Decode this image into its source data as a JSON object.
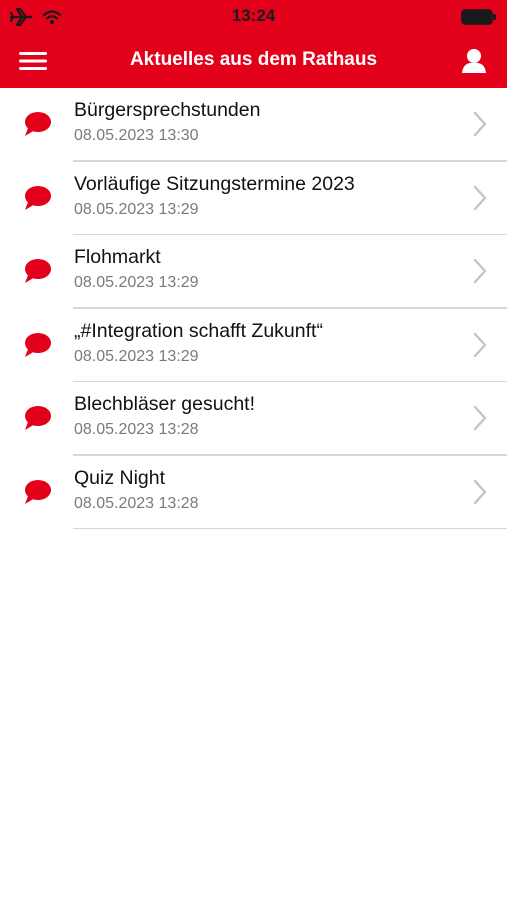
{
  "status_bar": {
    "time": "13:24",
    "icons": [
      "airplane-icon",
      "wifi-icon",
      "battery-icon"
    ]
  },
  "header": {
    "title": "Aktuelles aus dem Rathaus",
    "left_icon": "menu-icon",
    "right_icon": "user-icon"
  },
  "colors": {
    "brand": "#e2001a",
    "divider": "#d6d6d6",
    "chevron": "#c4c4c8"
  },
  "news": {
    "items": [
      {
        "title": "Bürgersprechstunden",
        "date": "08.05.2023 13:30"
      },
      {
        "title": "Vorläufige Sitzungstermine 2023",
        "date": "08.05.2023 13:29"
      },
      {
        "title": "Flohmarkt",
        "date": "08.05.2023 13:29"
      },
      {
        "title": "„#Integration schafft Zukunft“",
        "date": "08.05.2023 13:29"
      },
      {
        "title": "Blechbläser gesucht!",
        "date": "08.05.2023 13:28"
      },
      {
        "title": "Quiz Night",
        "date": "08.05.2023 13:28"
      }
    ]
  }
}
